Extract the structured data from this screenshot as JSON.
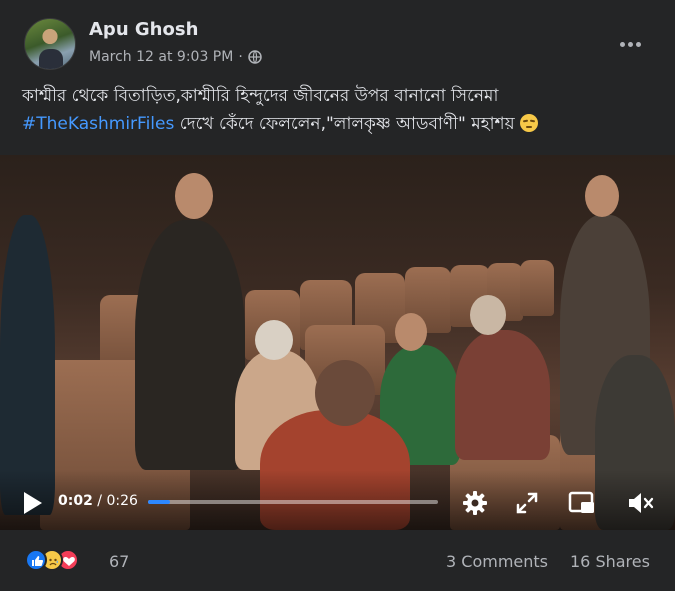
{
  "post": {
    "author": "Apu Ghosh",
    "timestamp": "March 12 at 9:03 PM",
    "separator": "·",
    "audience_icon": "globe-icon",
    "more_icon": "more-options-icon"
  },
  "caption": {
    "line1": "কাশ্মীর থেকে বিতাড়িত,কাশ্মীরি হিন্দুদের জীবনের উপর বানানো সিনেমা",
    "hashtag": "#TheKashmirFiles",
    "line2_rest": " দেখে কেঁদে ফেললেন,\"লালকৃষ্ণ আডবাণী\" মহাশয় ",
    "emoji": "pensive-face"
  },
  "video": {
    "current_time": "0:02",
    "time_separator": " / ",
    "duration": "0:26",
    "progress": 0.077,
    "icons": [
      "play-icon",
      "settings-icon",
      "fullscreen-icon",
      "picture-in-picture-icon",
      "mute-icon"
    ]
  },
  "footer": {
    "reaction_icons": [
      "like-icon",
      "sad-icon",
      "love-icon"
    ],
    "reaction_count": "67",
    "comments": "3 Comments",
    "shares": "16 Shares"
  },
  "colors": {
    "background": "#242526",
    "text_primary": "#e4e6eb",
    "text_secondary": "#b0b3b8",
    "link": "#4599ff",
    "progress": "#2d88ff"
  }
}
